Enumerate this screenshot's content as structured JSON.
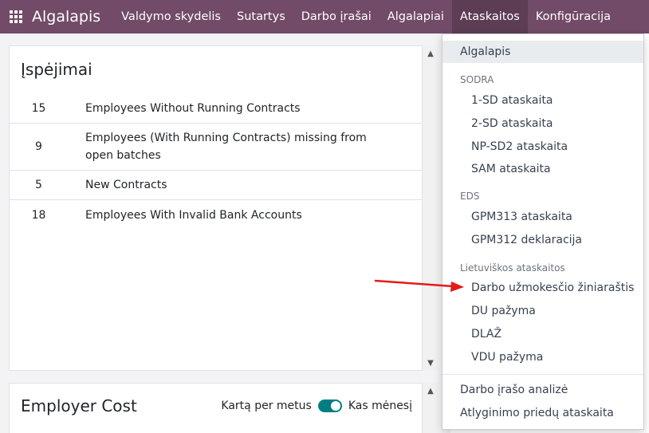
{
  "navbar": {
    "brand": "Algalapis",
    "items": [
      "Valdymo skydelis",
      "Sutartys",
      "Darbo įrašai",
      "Algalapiai",
      "Ataskaitos",
      "Konfigūracija"
    ],
    "active_index": 4
  },
  "warnings": {
    "title": "Įspėjimai",
    "rows": [
      {
        "count": "15",
        "label": "Employees Without Running Contracts"
      },
      {
        "count": "9",
        "label": "Employees (With Running Contracts) missing from open batches"
      },
      {
        "count": "5",
        "label": "New Contracts"
      },
      {
        "count": "18",
        "label": "Employees With Invalid Bank Accounts"
      }
    ]
  },
  "employer_cost": {
    "title": "Employer Cost",
    "toggle_left": "Kartą per metus",
    "toggle_right": "Kas mėnesį"
  },
  "dropdown": {
    "top_item": "Algalapis",
    "sections": [
      {
        "header": "SODRA",
        "items": [
          "1-SD ataskaita",
          "2-SD ataskaita",
          "NP-SD2 ataskaita",
          "SAM ataskaita"
        ]
      },
      {
        "header": "EDS",
        "items": [
          "GPM313 ataskaita",
          "GPM312 deklaracija"
        ]
      },
      {
        "header": "Lietuviškos ataskaitos",
        "items": [
          "Darbo užmokesčio žiniaraštis",
          "DU pažyma",
          "DLAŽ",
          "VDU pažyma"
        ]
      }
    ],
    "bottom_items": [
      "Darbo įrašo analizė",
      "Atlyginimo priedų ataskaita"
    ]
  },
  "colors": {
    "navbar": "#714b67",
    "toggle": "#017e84",
    "arrow": "#e31b1b"
  }
}
